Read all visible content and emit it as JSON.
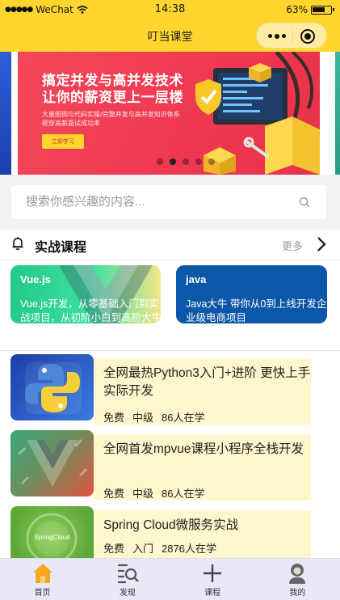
{
  "status_bar": {
    "carrier": "WeChat",
    "time": "14:38",
    "battery": "63%"
  },
  "nav": {
    "title": "叮当课堂"
  },
  "banner": {
    "title_line1": "搞定并发与高并发技术",
    "title_line2": "让你的薪资更上一层楼",
    "sub_line1": "大量图例与代码实操/完整并发与高并发知识体系",
    "sub_line2": "砸穿高薪面试成功率",
    "button": "立即学习",
    "page_count": 5,
    "active_page": 1
  },
  "search": {
    "placeholder": "搜索你感兴趣的内容..."
  },
  "section": {
    "title": "实战课程",
    "more": "更多"
  },
  "featured": [
    {
      "title": "Vue.js",
      "desc": "Vue.js开发，从零基础入门到实战项目，从初阶小白到高阶大牛Vue.js开发。"
    },
    {
      "title": "java",
      "desc": "Java大牛 带你从0到上线开发企业级电商项目"
    }
  ],
  "courses": [
    {
      "title": "全网最热Python3入门+进阶 更快上手实际开发",
      "price": "免费",
      "level": "中级",
      "learners": "86人在学",
      "thumb": "python-logo"
    },
    {
      "title": "全网首发mpvue课程小程序全栈开发",
      "price": "免费",
      "level": "中级",
      "learners": "86人在学",
      "thumb": "vue-logo"
    },
    {
      "title": "Spring Cloud微服务实战",
      "price": "免费",
      "level": "入门",
      "learners": "2876人在学",
      "thumb": "spring-cloud-logo",
      "thumb_text": "SpringCloud"
    }
  ],
  "tabs": [
    {
      "label": "首页",
      "icon": "home-icon",
      "active": true
    },
    {
      "label": "发现",
      "icon": "discover-icon",
      "active": false
    },
    {
      "label": "课程",
      "icon": "plus-icon",
      "active": false
    },
    {
      "label": "我的",
      "icon": "user-icon",
      "active": false
    }
  ],
  "colors": {
    "brand_yellow": "#ffd52e",
    "banner_red": "#ee3850",
    "course_bg": "#fef6cc",
    "tab_bg": "#e9e8f8",
    "home_active": "#f5a623"
  }
}
